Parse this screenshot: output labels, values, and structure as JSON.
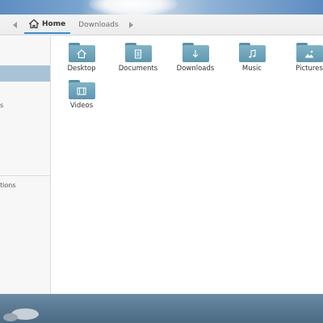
{
  "breadcrumb": {
    "home_label": "Home",
    "next_label": "Downloads"
  },
  "sidebar": {
    "fragments": [
      "s",
      "tions"
    ]
  },
  "content": {
    "items": [
      {
        "label": "Desktop",
        "icon": "home-emblem-icon"
      },
      {
        "label": "Documents",
        "icon": "document-emblem-icon"
      },
      {
        "label": "Downloads",
        "icon": "download-emblem-icon"
      },
      {
        "label": "Music",
        "icon": "music-emblem-icon"
      },
      {
        "label": "Pictures",
        "icon": "picture-emblem-icon"
      },
      {
        "label": "Videos",
        "icon": "video-emblem-icon"
      }
    ]
  },
  "colors": {
    "accent": "#2f8ed6",
    "selection": "#a9c3d6",
    "folder": "#6ea6bd"
  }
}
